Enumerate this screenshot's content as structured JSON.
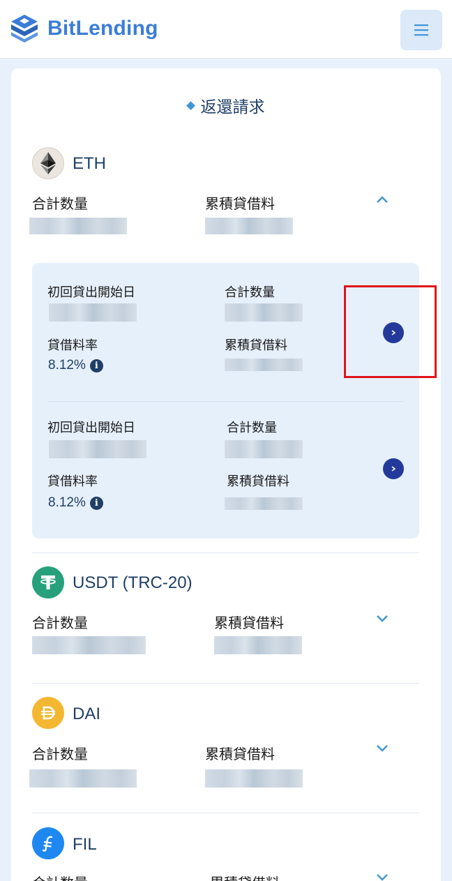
{
  "header": {
    "brand": "BitLending",
    "menu_icon": "hamburger-icon"
  },
  "page": {
    "title": "返還請求"
  },
  "colors": {
    "brand_blue": "#3b7dd8",
    "navy": "#1f3f66",
    "action_button": "#23399b",
    "panel_bg": "#e6f0fb",
    "highlight": "#e0141b"
  },
  "coins": [
    {
      "name": "ETH",
      "icon": "ethereum-icon",
      "total_label": "合計数量",
      "fee_label": "累積貸借料",
      "expanded": true,
      "lendings": [
        {
          "start_label": "初回貸出開始日",
          "total_label": "合計数量",
          "rate_label": "貸借料率",
          "rate_value": "8.12%",
          "fee_label": "累積貸借料"
        },
        {
          "start_label": "初回貸出開始日",
          "total_label": "合計数量",
          "rate_label": "貸借料率",
          "rate_value": "8.12%",
          "fee_label": "累積貸借料"
        }
      ]
    },
    {
      "name": "USDT (TRC-20)",
      "icon": "tether-icon",
      "total_label": "合計数量",
      "fee_label": "累積貸借料",
      "expanded": false
    },
    {
      "name": "DAI",
      "icon": "dai-icon",
      "total_label": "合計数量",
      "fee_label": "累積貸借料",
      "expanded": false
    },
    {
      "name": "FIL",
      "icon": "filecoin-icon",
      "total_label": "合計数量",
      "fee_label": "累積貸借料",
      "expanded": false
    }
  ]
}
